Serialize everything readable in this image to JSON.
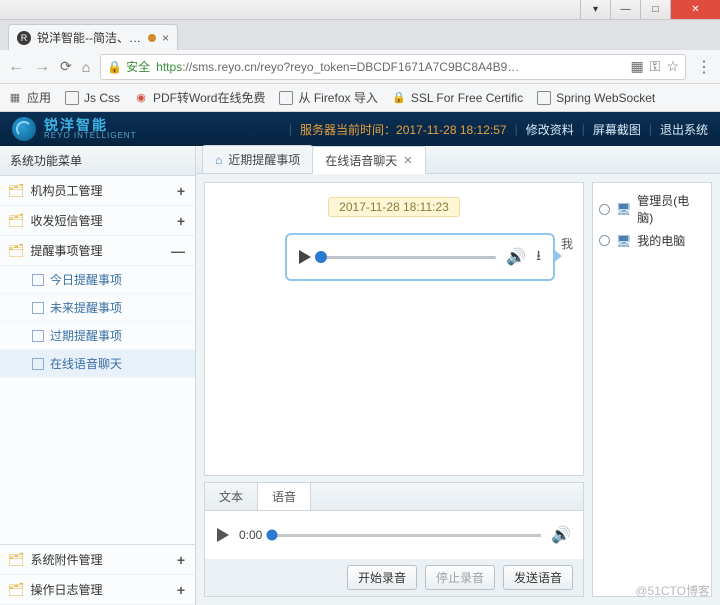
{
  "window": {
    "minimize": "—",
    "maximize": "□",
    "dropdown": "▾",
    "close": "✕"
  },
  "browser_tab": {
    "title": "锐洋智能--简洁、实用",
    "close": "×"
  },
  "addr": {
    "secure_label": "安全",
    "scheme": "https",
    "rest": "://sms.reyo.cn/reyo?reyo_token=DBCDF1671A7C9BC8A4B9…"
  },
  "bookmarks": {
    "apps": "应用",
    "items": [
      {
        "label": "Js Css"
      },
      {
        "label": "PDF转Word在线免费"
      },
      {
        "label": "从 Firefox 导入"
      },
      {
        "label": "SSL For Free Certific"
      },
      {
        "label": "Spring WebSocket"
      }
    ]
  },
  "header": {
    "brand_cn": "锐洋智能",
    "brand_en": "REYO INTELLIGENT",
    "server_time_label": "服务器当前时间：",
    "server_time": "2017-11-28 18:12:57",
    "links": {
      "profile": "修改资料",
      "screenshot": "屏幕截图",
      "logout": "退出系统"
    }
  },
  "sidebar": {
    "title": "系统功能菜单",
    "groups": [
      {
        "label": "机构员工管理",
        "state": "+"
      },
      {
        "label": "收发短信管理",
        "state": "+"
      },
      {
        "label": "提醒事项管理",
        "state": "—",
        "children": [
          {
            "label": "今日提醒事项"
          },
          {
            "label": "未来提醒事项"
          },
          {
            "label": "过期提醒事项"
          },
          {
            "label": "在线语音聊天",
            "active": true
          }
        ]
      }
    ],
    "footer": [
      {
        "label": "系统附件管理",
        "state": "+"
      },
      {
        "label": "操作日志管理",
        "state": "+"
      }
    ]
  },
  "tabs": [
    {
      "label": "近期提醒事项",
      "home": true
    },
    {
      "label": "在线语音聊天",
      "active": true,
      "closable": true
    }
  ],
  "chat": {
    "timestamp": "2017-11-28 18:11:23",
    "sender": "我"
  },
  "compose": {
    "tabs": {
      "text": "文本",
      "voice": "语音"
    },
    "time": "0:00",
    "actions": {
      "start": "开始录音",
      "stop": "停止录音",
      "send": "发送语音"
    }
  },
  "rside": {
    "items": [
      {
        "label": "管理员(电脑)"
      },
      {
        "label": "我的电脑"
      }
    ]
  },
  "watermark": "@51CTO博客"
}
